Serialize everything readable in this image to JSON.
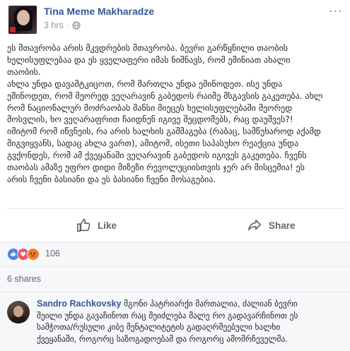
{
  "post": {
    "author": "Tina Meme Makharadze",
    "timestamp": "3 hrs",
    "separator": "·",
    "options_glyph": "···",
    "text_lines": [
      "ეს მთავრობა არის მკვდრების მთავრობა. ბევრი გარწყნილი თაობის",
      "ხელისუფლებაა და ეს ყველაფერი იმას ნიშნავს, რომ ეშინიათ ახალი",
      "თაობის.",
      "ახლა უნდა დავამტკიცოთ, რომ მართლა უნდა ეშინოდეთ. ისე უნდა",
      "ეშინოდეთ, რომ მეორედ ვეღარავინ გაბედოს რაიმე მსგავსის გაკეთება. ახლ",
      "რომ ნაციონალურ მოძრაობას შანსი მიეცეს ხელისუფლებაში მეორედ",
      "მოსვლის, ხო ვეღარაფრით ჩაიდნენ იგივე შეცდომებს, რაც დაუშვეს?!",
      "იმიტომ რომ იწვნეის, რა არის ხალხის გაშმაგება (რაბაც, სამწუხაროდ აქამდ",
      "მიგვიყვანს, სადაც ახლა ვართ), ამიტომ, ისეთი საპასუხო რეაქცია უნდა",
      "გვქონდეს, რომ ამ ქვეყანაში ვეღარავინ გაბედოს იგივეს გაკეთება. ჩვენს",
      "თაობას ამაზე უფრო დიდი მიზეზი რევოლუციისთვის ჯერ არ მისცემია! ეს",
      "არის ჩვენი ბასიანი და ეს ბასიანი ჩვენი მოსაგებია."
    ]
  },
  "actions": {
    "like_label": "Like",
    "share_label": "Share"
  },
  "reactions": {
    "types": [
      "like",
      "love",
      "angry"
    ],
    "count": "106",
    "colors": {
      "like": "#4a7fea",
      "love": "#f25268",
      "angry": "#f07f2b"
    }
  },
  "shares": {
    "label": "6 shares"
  },
  "comments": [
    {
      "author": "Sandro Rachkovsky",
      "text_first": "მგონი პატრიარქი მართალია, ძალიან ბევრი",
      "text_lines": [
        "შეილი უნდა გავაჩინოთ რაც შეიძლება მალე რო გადავარჩინოთ ეს",
        "სამჭოთა/რუსული კიბე მენტალიტეტის გადაღრმეებული ხალხი",
        "ქვეყანაში, როგორც საზოგადოებამ და როგორც ამომრჩეველმა."
      ]
    }
  ],
  "colors": {
    "link": "#365899",
    "text": "#1d2129",
    "muted": "#90949c",
    "action": "#606770",
    "panel": "#f6f7f9"
  }
}
